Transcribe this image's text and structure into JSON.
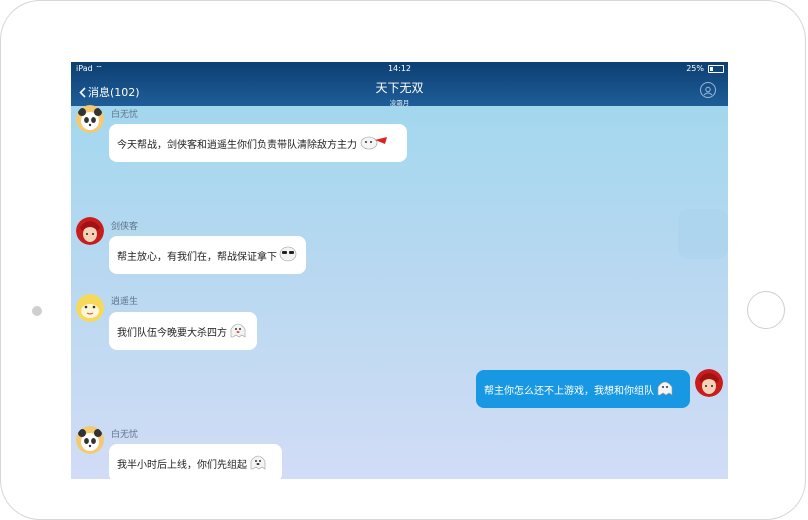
{
  "status_bar": {
    "carrier": "iPad",
    "time": "14:12",
    "battery": "25%"
  },
  "nav": {
    "back_label": "消息(102)",
    "title": "天下无双",
    "subtitle": "凌霜月"
  },
  "messages": [
    {
      "sender": "白无忧",
      "text": "今天帮战，剑侠客和逍遥生你们负责带队清除敌方主力",
      "emoji": "crab-emoji",
      "direction": "incoming"
    },
    {
      "sender": "剑侠客",
      "text": "帮主放心，有我们在，帮战保证拿下",
      "emoji": "sunglasses-emoji",
      "direction": "incoming"
    },
    {
      "sender": "逍遥生",
      "text": "我们队伍今晚要大杀四方",
      "emoji": "ghost-emoji",
      "direction": "incoming"
    },
    {
      "sender": "",
      "text": "帮主你怎么还不上游戏，我想和你组队",
      "emoji": "ghost-emoji",
      "direction": "outgoing"
    },
    {
      "sender": "白无忧",
      "text": "我半小时后上线，你们先组起",
      "emoji": "ghost-emoji",
      "direction": "incoming"
    }
  ],
  "colors": {
    "nav_bg": "#0c3f72",
    "outgoing_bubble": "#1898e3",
    "incoming_bubble": "#ffffff",
    "chat_bg_top": "#9dd7ee",
    "chat_bg_bottom": "#d2dcf6"
  }
}
